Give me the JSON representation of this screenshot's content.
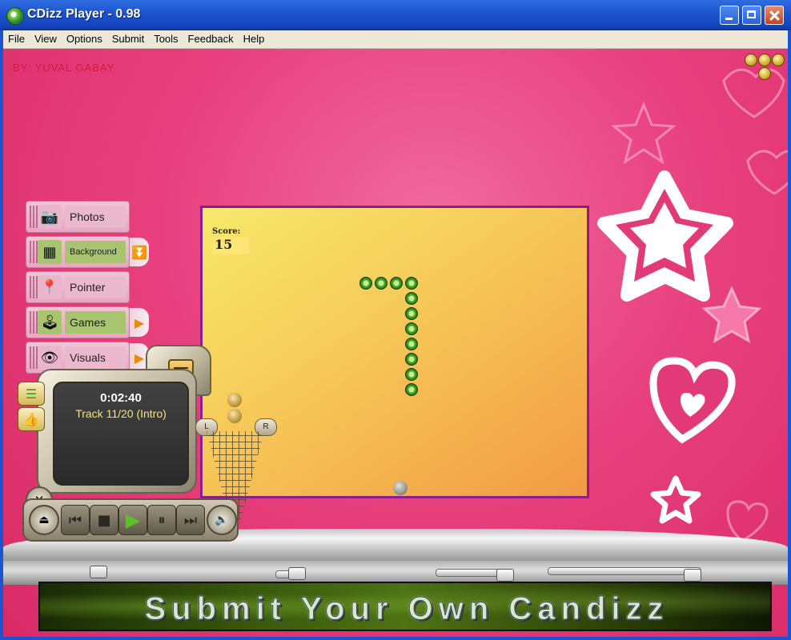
{
  "window": {
    "title": "CDizz Player - 0.98"
  },
  "menu": [
    "File",
    "View",
    "Options",
    "Submit",
    "Tools",
    "Feedback",
    "Help"
  ],
  "stage": {
    "credit": "BY: YUVAL GABAY"
  },
  "side_menu": {
    "photos": "Photos",
    "background": "Background",
    "pointer": "Pointer",
    "games": "Games",
    "visuals": "Visuals"
  },
  "game": {
    "score_label": "Score:",
    "score_value": "15"
  },
  "player": {
    "time": "0:02:40",
    "track": "Track 11/20 (Intro)"
  },
  "balance": {
    "left_label": "L",
    "right_label": "R"
  },
  "banner": {
    "text": "Submit Your Own Candizz"
  },
  "colors": {
    "background_pink": "#e8407e",
    "game_border": "#8a1e8e",
    "highlight_green": "#a9c46e",
    "title_blue": "#1c53d0"
  }
}
